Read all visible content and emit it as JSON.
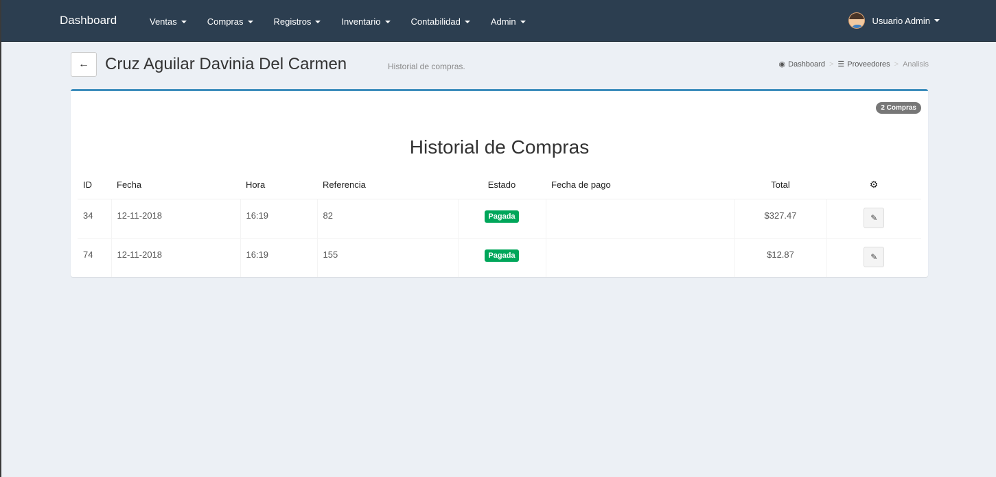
{
  "navbar": {
    "brand": "Dashboard",
    "items": [
      {
        "label": "Ventas"
      },
      {
        "label": "Compras"
      },
      {
        "label": "Registros"
      },
      {
        "label": "Inventario"
      },
      {
        "label": "Contabilidad"
      },
      {
        "label": "Admin"
      }
    ],
    "user": "Usuario Admin",
    "background": "#2c3e50"
  },
  "header": {
    "title": "Cruz Aguilar Davinia Del Carmen",
    "subtitle": "Historial de compras.",
    "breadcrumb": [
      "Dashboard",
      "Proveedores",
      "Analisis"
    ]
  },
  "box": {
    "badge": "2 Compras",
    "title": "Historial de Compras",
    "accent": "#3c8dbc",
    "columns": [
      "ID",
      "Fecha",
      "Hora",
      "Referencia",
      "Estado",
      "Fecha de pago",
      "Total"
    ],
    "rows": [
      {
        "id": "34",
        "fecha": "12-11-2018",
        "hora": "16:19",
        "ref": "82",
        "estado": "Pagada",
        "pago": "",
        "total": "$327.47"
      },
      {
        "id": "74",
        "fecha": "12-11-2018",
        "hora": "16:19",
        "ref": "155",
        "estado": "Pagada",
        "pago": "",
        "total": "$12.87"
      }
    ],
    "status_color": "#00a65a"
  },
  "icons": {
    "back": "arrow-left-icon",
    "gear": "gear-icon",
    "edit": "pencil-icon",
    "dashboard": "dashboard-icon",
    "list": "list-icon"
  }
}
